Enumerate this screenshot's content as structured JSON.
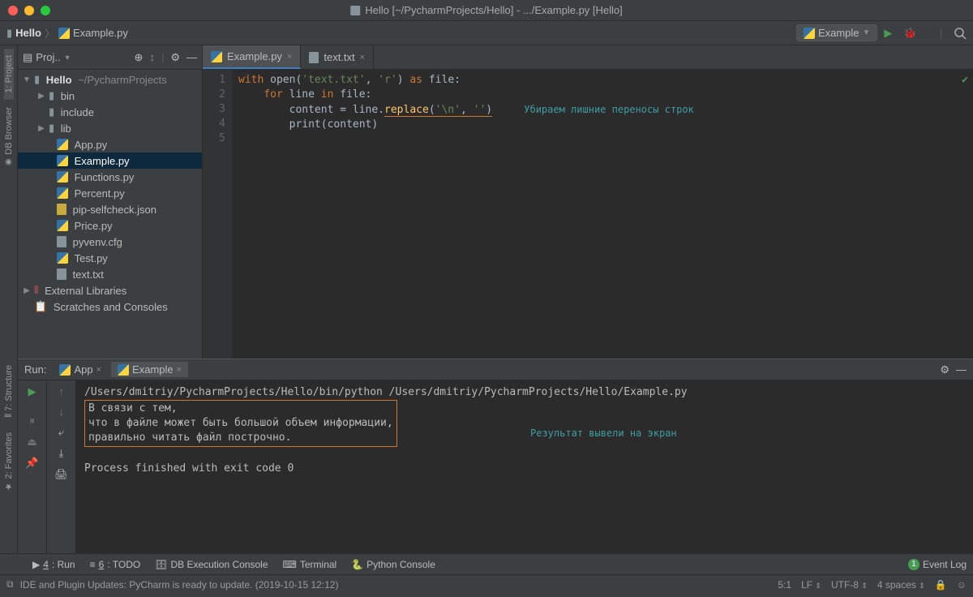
{
  "window": {
    "title": "Hello [~/PycharmProjects/Hello] - .../Example.py [Hello]"
  },
  "breadcrumb": {
    "project": "Hello",
    "file": "Example.py"
  },
  "run_config": {
    "label": "Example"
  },
  "project_panel": {
    "title": "Proj..",
    "root": {
      "name": "Hello",
      "path": "~/PycharmProjects"
    },
    "folders": [
      "bin",
      "include",
      "lib"
    ],
    "files": [
      "App.py",
      "Example.py",
      "Functions.py",
      "Percent.py",
      "pip-selfcheck.json",
      "Price.py",
      "pyvenv.cfg",
      "Test.py",
      "text.txt"
    ],
    "external": "External Libraries",
    "scratches": "Scratches and Consoles"
  },
  "tabs": [
    {
      "label": "Example.py",
      "active": true
    },
    {
      "label": "text.txt",
      "active": false
    }
  ],
  "code": {
    "lines": [
      "1",
      "2",
      "3",
      "4",
      "5"
    ],
    "l1_kw1": "with",
    "l1_fn": "open",
    "l1_str": "'text.txt'",
    "l1_comma": ", ",
    "l1_str2": "'r'",
    "l1_kw2": "as",
    "l1_id": "file:",
    "l2_kw": "for",
    "l2_id": "line",
    "l2_kw2": "in",
    "l2_id2": "file:",
    "l3_id": "content = line.",
    "l3_fn": "replace",
    "l3_str": "'\\n'",
    "l3_comma": ", ",
    "l3_str2": "''",
    "l4_fn": "print",
    "l4_id": "(content)",
    "annotation": "Убираем лишние переносы строк"
  },
  "run": {
    "label": "Run:",
    "tabs": [
      "App",
      "Example"
    ],
    "command": "/Users/dmitriy/PycharmProjects/Hello/bin/python /Users/dmitriy/PycharmProjects/Hello/Example.py",
    "output1": "В связи с тем,",
    "output2": "что в файле может быть большой объем информации,",
    "output3": "правильно читать файл построчно.",
    "annotation": "Результат вывели на экран",
    "exit": "Process finished with exit code 0",
    "gear_tooltip": "Settings"
  },
  "bottom": {
    "run": "4: Run",
    "todo": "6: TODO",
    "db": "DB Execution Console",
    "terminal": "Terminal",
    "pyconsole": "Python Console",
    "eventlog": "Event Log",
    "event_count": "1"
  },
  "status": {
    "message": "IDE and Plugin Updates: PyCharm is ready to update. (2019-10-15 12:12)",
    "pos": "5:1",
    "lf": "LF",
    "enc": "UTF-8",
    "indent": "4 spaces"
  },
  "sidebar": {
    "project": "1: Project",
    "db": "DB Browser",
    "structure": "7: Structure",
    "favorites": "2: Favorites"
  }
}
